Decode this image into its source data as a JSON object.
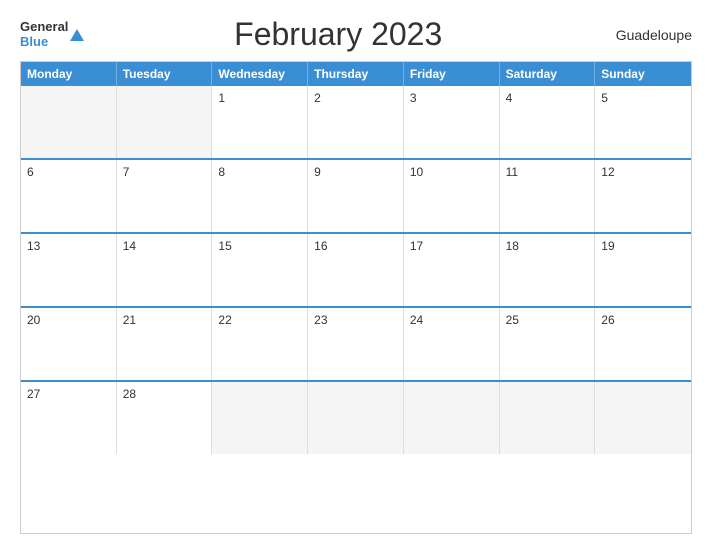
{
  "header": {
    "title": "February 2023",
    "region": "Guadeloupe",
    "logo": {
      "general": "General",
      "blue": "Blue"
    }
  },
  "calendar": {
    "days_of_week": [
      "Monday",
      "Tuesday",
      "Wednesday",
      "Thursday",
      "Friday",
      "Saturday",
      "Sunday"
    ],
    "weeks": [
      [
        {
          "day": "",
          "empty": true
        },
        {
          "day": "",
          "empty": true
        },
        {
          "day": "1",
          "empty": false
        },
        {
          "day": "2",
          "empty": false
        },
        {
          "day": "3",
          "empty": false
        },
        {
          "day": "4",
          "empty": false
        },
        {
          "day": "5",
          "empty": false
        }
      ],
      [
        {
          "day": "6",
          "empty": false
        },
        {
          "day": "7",
          "empty": false
        },
        {
          "day": "8",
          "empty": false
        },
        {
          "day": "9",
          "empty": false
        },
        {
          "day": "10",
          "empty": false
        },
        {
          "day": "11",
          "empty": false
        },
        {
          "day": "12",
          "empty": false
        }
      ],
      [
        {
          "day": "13",
          "empty": false
        },
        {
          "day": "14",
          "empty": false
        },
        {
          "day": "15",
          "empty": false
        },
        {
          "day": "16",
          "empty": false
        },
        {
          "day": "17",
          "empty": false
        },
        {
          "day": "18",
          "empty": false
        },
        {
          "day": "19",
          "empty": false
        }
      ],
      [
        {
          "day": "20",
          "empty": false
        },
        {
          "day": "21",
          "empty": false
        },
        {
          "day": "22",
          "empty": false
        },
        {
          "day": "23",
          "empty": false
        },
        {
          "day": "24",
          "empty": false
        },
        {
          "day": "25",
          "empty": false
        },
        {
          "day": "26",
          "empty": false
        }
      ],
      [
        {
          "day": "27",
          "empty": false
        },
        {
          "day": "28",
          "empty": false
        },
        {
          "day": "",
          "empty": true
        },
        {
          "day": "",
          "empty": true
        },
        {
          "day": "",
          "empty": true
        },
        {
          "day": "",
          "empty": true
        },
        {
          "day": "",
          "empty": true
        }
      ]
    ]
  }
}
